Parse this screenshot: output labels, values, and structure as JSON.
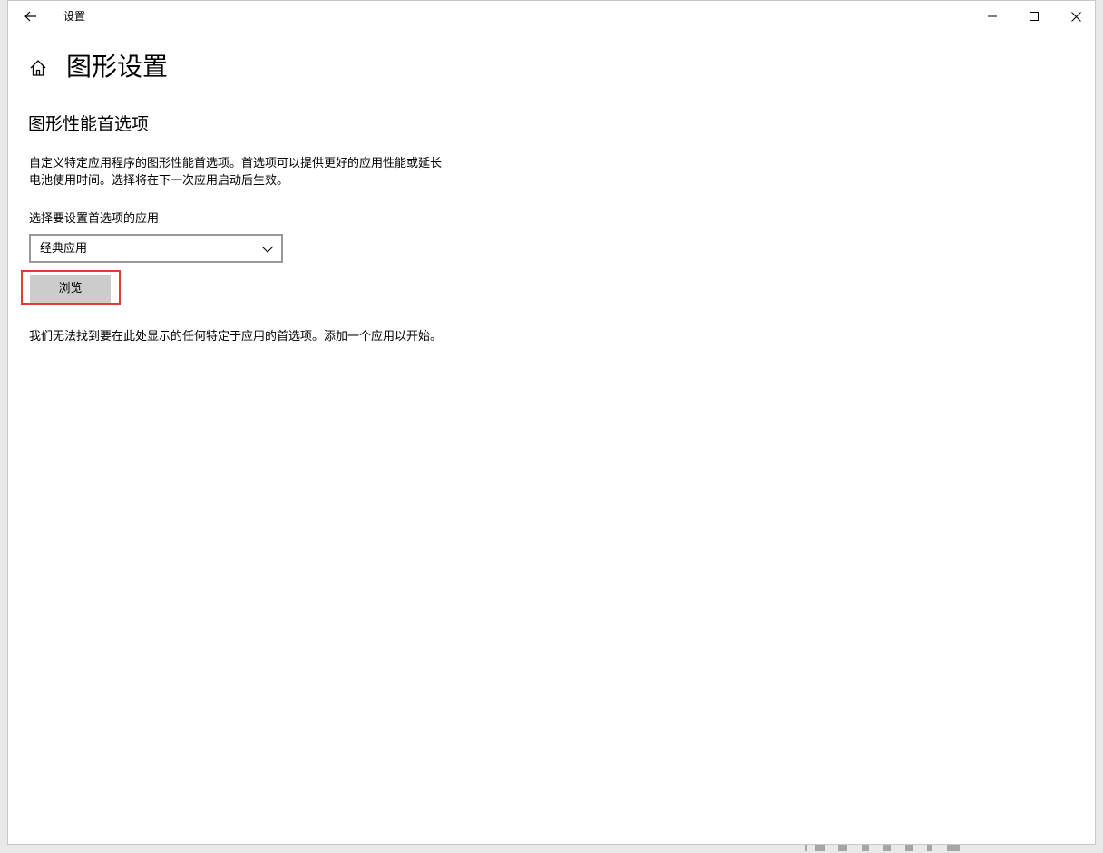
{
  "window": {
    "title": "设置"
  },
  "page": {
    "title": "图形设置",
    "section_title": "图形性能首选项",
    "description": "自定义特定应用程序的图形性能首选项。首选项可以提供更好的应用性能或延长电池使用时间。选择将在下一次应用启动后生效。",
    "select_label": "选择要设置首选项的应用",
    "dropdown_value": "经典应用",
    "browse_label": "浏览",
    "empty_message": "我们无法找到要在此处显示的任何特定于应用的首选项。添加一个应用以开始。"
  },
  "icons": {
    "back": "arrow-left-icon",
    "home": "home-icon",
    "dropdown": "chevron-down-icon",
    "minimize": "minimize-icon",
    "maximize": "maximize-icon",
    "close": "close-icon"
  },
  "colors": {
    "highlight": "#e53935",
    "button_bg": "#cccccc",
    "dropdown_border": "#999999"
  }
}
